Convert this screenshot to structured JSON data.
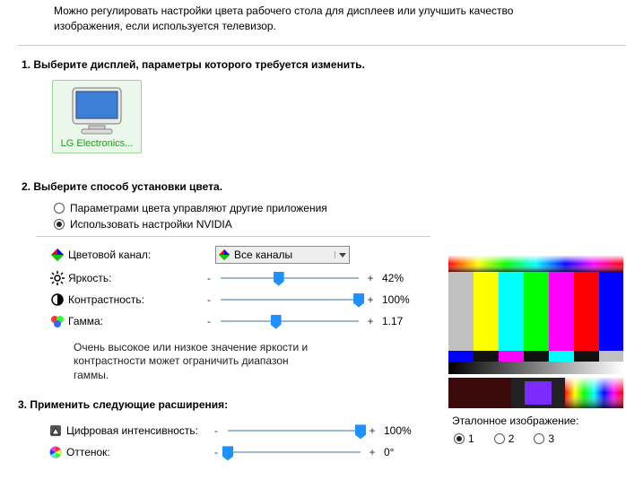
{
  "intro": "Можно регулировать настройки цвета рабочего стола для дисплеев или улучшить качество изображения, если используется телевизор.",
  "section1": {
    "title": "1. Выберите дисплей, параметры которого требуется изменить.",
    "display_label": "LG Electronics..."
  },
  "section2": {
    "title": "2. Выберите способ установки цвета.",
    "radio_other_apps": "Параметрами цвета управляют другие приложения",
    "radio_nvidia": "Использовать настройки NVIDIA",
    "channel": {
      "label": "Цветовой канал:",
      "value": "Все каналы"
    },
    "brightness": {
      "label": "Яркость:",
      "value": "42%"
    },
    "contrast": {
      "label": "Контрастность:",
      "value": "100%"
    },
    "gamma": {
      "label": "Гамма:",
      "value": "1.17"
    },
    "note": "Очень высокое или низкое значение яркости и контрастности может ограничить диапазон гаммы."
  },
  "section3": {
    "title": "3. Применить следующие расширения:",
    "digital_vibrance": {
      "label": "Цифровая интенсивность:",
      "value": "100%"
    },
    "hue": {
      "label": "Оттенок:",
      "value": "0°"
    }
  },
  "reference": {
    "label": "Эталонное изображение:",
    "opt1": "1",
    "opt2": "2",
    "opt3": "3"
  },
  "signs": {
    "minus": "-",
    "plus": "+"
  }
}
